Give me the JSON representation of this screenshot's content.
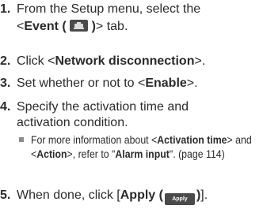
{
  "steps": [
    {
      "num": "1.",
      "line1": "From the Setup menu, select the",
      "line2_pre": "<",
      "line2_bold": "Event (",
      "line2_bold_after": ")",
      "line2_post": "> tab.",
      "icon": "event-camera-icon"
    },
    {
      "num": "2.",
      "pre": "Click <",
      "bold": "Network disconnection",
      "post": ">."
    },
    {
      "num": "3.",
      "pre": "Set whether or not to <",
      "bold": "Enable",
      "post": ">."
    },
    {
      "num": "4.",
      "line1": "Specify the activation time and",
      "line2": "activation condition."
    },
    {
      "num": "5.",
      "pre": "When done, click [",
      "bold": "Apply (",
      "button_label": "Apply",
      "bold_after": ")",
      "post": "]."
    }
  ],
  "note": {
    "part1": "For more information about <",
    "bold1": "Activation time",
    "part2": "> and <",
    "bold2": "Action",
    "part3": ">, refer to \"",
    "bold3": "Alarm input",
    "part4": "\". (page 114)"
  }
}
